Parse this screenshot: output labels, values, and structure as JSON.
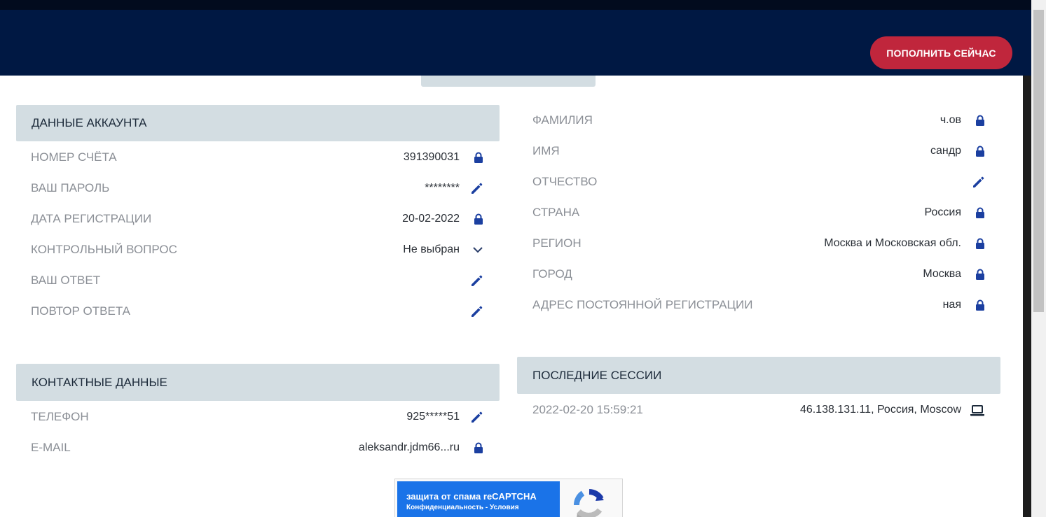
{
  "header": {
    "topup_label": "ПОПОЛНИТЬ СЕЙЧАС"
  },
  "account": {
    "title": "ДАННЫЕ АККАУНТА",
    "rows": [
      {
        "label": "НОМЕР СЧЁТА",
        "value": "391390031",
        "icon": "lock-icon"
      },
      {
        "label": "ВАШ ПАРОЛЬ",
        "value": "********",
        "icon": "pencil-icon"
      },
      {
        "label": "ДАТА РЕГИСТРАЦИИ",
        "value": "20-02-2022",
        "icon": "lock-icon"
      },
      {
        "label": "КОНТРОЛЬНЫЙ ВОПРОС",
        "value": "Не выбран",
        "icon": "chevron-down-icon"
      },
      {
        "label": "ВАШ ОТВЕТ",
        "value": "",
        "icon": "pencil-icon"
      },
      {
        "label": "ПОВТОР ОТВЕТА",
        "value": "",
        "icon": "pencil-icon"
      }
    ]
  },
  "personal": {
    "rows": [
      {
        "label": "ФАМИЛИЯ",
        "value": "ч.ов",
        "icon": "lock-icon"
      },
      {
        "label": "ИМЯ",
        "value": "сандр",
        "icon": "lock-icon"
      },
      {
        "label": "ОТЧЕСТВО",
        "value": "",
        "icon": "pencil-icon"
      },
      {
        "label": "СТРАНА",
        "value": "Россия",
        "icon": "lock-icon"
      },
      {
        "label": "РЕГИОН",
        "value": "Москва и Московская обл.",
        "icon": "lock-icon"
      },
      {
        "label": "ГОРОД",
        "value": "Москва",
        "icon": "lock-icon"
      },
      {
        "label": "АДРЕС ПОСТОЯННОЙ РЕГИСТРАЦИИ",
        "value": "ная",
        "icon": "lock-icon"
      }
    ]
  },
  "contacts": {
    "title": "КОНТАКТНЫЕ ДАННЫЕ",
    "rows": [
      {
        "label": "ТЕЛЕФОН",
        "value": "925*****51",
        "icon": "pencil-icon"
      },
      {
        "label": "E-MAIL",
        "value": "aleksandr.jdm66...ru",
        "icon": "lock-icon"
      }
    ]
  },
  "sessions": {
    "title": "ПОСЛЕДНИЕ СЕССИИ",
    "items": [
      {
        "date": "2022-02-20 15:59:21",
        "info": "46.138.131.11, Россия, Moscow",
        "icon": "laptop-icon"
      }
    ]
  },
  "recaptcha": {
    "line1": "защита от спама reCAPTCHA",
    "line2": "Конфиденциальность - Условия"
  },
  "colors": {
    "header": "#001843",
    "accent": "#c0263c",
    "icon": "#1b3fa0",
    "section": "#d3dde2"
  }
}
